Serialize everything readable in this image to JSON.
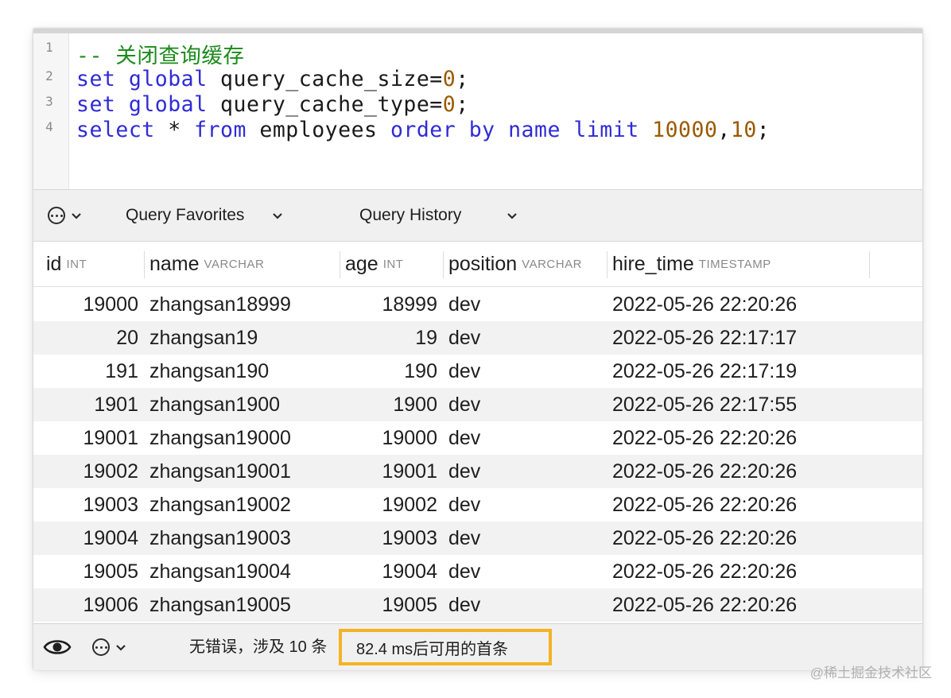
{
  "editor": {
    "line_numbers": [
      "1",
      "2",
      "3",
      "4"
    ],
    "lines": [
      [
        {
          "t": "-- 关闭查询缓存",
          "c": "cm"
        }
      ],
      [
        {
          "t": "set",
          "c": "kw"
        },
        {
          "t": " "
        },
        {
          "t": "global",
          "c": "kw"
        },
        {
          "t": " query_cache_size="
        },
        {
          "t": "0",
          "c": "num"
        },
        {
          "t": ";"
        }
      ],
      [
        {
          "t": "set",
          "c": "kw"
        },
        {
          "t": " "
        },
        {
          "t": "global",
          "c": "kw"
        },
        {
          "t": " query_cache_type="
        },
        {
          "t": "0",
          "c": "num"
        },
        {
          "t": ";"
        }
      ],
      [
        {
          "t": "select",
          "c": "kw"
        },
        {
          "t": " * "
        },
        {
          "t": "from",
          "c": "kw"
        },
        {
          "t": " employees "
        },
        {
          "t": "order",
          "c": "kw"
        },
        {
          "t": " "
        },
        {
          "t": "by",
          "c": "kw"
        },
        {
          "t": " "
        },
        {
          "t": "name",
          "c": "kw"
        },
        {
          "t": " "
        },
        {
          "t": "limit",
          "c": "kw"
        },
        {
          "t": " "
        },
        {
          "t": "10000",
          "c": "num"
        },
        {
          "t": ","
        },
        {
          "t": "10",
          "c": "num"
        },
        {
          "t": ";"
        }
      ]
    ]
  },
  "toolbar": {
    "favorites_label": "Query Favorites",
    "history_label": "Query History"
  },
  "grid": {
    "columns": [
      {
        "name": "id",
        "type": "INT"
      },
      {
        "name": "name",
        "type": "VARCHAR"
      },
      {
        "name": "age",
        "type": "INT"
      },
      {
        "name": "position",
        "type": "VARCHAR"
      },
      {
        "name": "hire_time",
        "type": "TIMESTAMP"
      }
    ],
    "rows": [
      [
        "19000",
        "zhangsan18999",
        "18999",
        "dev",
        "2022-05-26 22:20:26"
      ],
      [
        "20",
        "zhangsan19",
        "19",
        "dev",
        "2022-05-26 22:17:17"
      ],
      [
        "191",
        "zhangsan190",
        "190",
        "dev",
        "2022-05-26 22:17:19"
      ],
      [
        "1901",
        "zhangsan1900",
        "1900",
        "dev",
        "2022-05-26 22:17:55"
      ],
      [
        "19001",
        "zhangsan19000",
        "19000",
        "dev",
        "2022-05-26 22:20:26"
      ],
      [
        "19002",
        "zhangsan19001",
        "19001",
        "dev",
        "2022-05-26 22:20:26"
      ],
      [
        "19003",
        "zhangsan19002",
        "19002",
        "dev",
        "2022-05-26 22:20:26"
      ],
      [
        "19004",
        "zhangsan19003",
        "19003",
        "dev",
        "2022-05-26 22:20:26"
      ],
      [
        "19005",
        "zhangsan19004",
        "19004",
        "dev",
        "2022-05-26 22:20:26"
      ],
      [
        "19006",
        "zhangsan19005",
        "19005",
        "dev",
        "2022-05-26 22:20:26"
      ]
    ]
  },
  "status": {
    "message": "无错误，涉及 10 条",
    "timing": "82.4 ms后可用的首条",
    "highlight_color": "#f5b324"
  },
  "icons": {
    "view": "eye-icon",
    "more": "more-options-icon",
    "dropdown": "chevron-down-icon"
  },
  "watermark": "@稀土掘金技术社区"
}
